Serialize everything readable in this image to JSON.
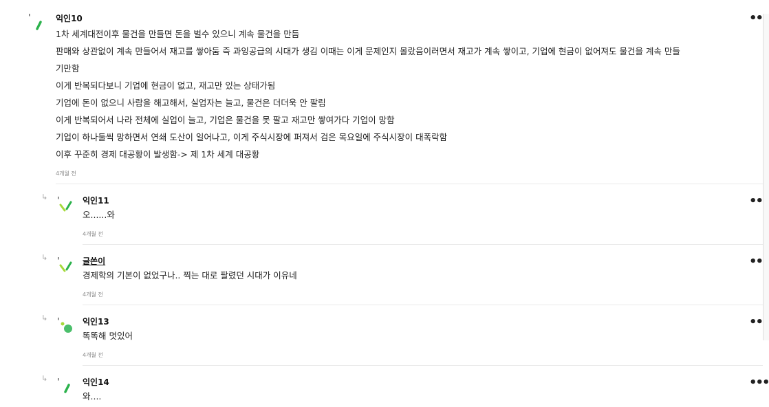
{
  "comments": [
    {
      "author": "익인10",
      "lines": [
        "1차 세계대전이후 물건을 만들면 돈을 벌수 있으니 계속 물건을 만듬",
        "판매와 상관없이 계속 만들어서 재고를 쌓아둠 즉 과잉공급의 시대가 생김 이때는 이게 문제인지 몰랐음이러면서 재고가 계속 쌓이고, 기업에 현금이 없어져도 물건을 계속 만들",
        "기만함",
        "이게 반복되다보니 기업에 현금이 없고, 재고만 있는 상태가됨",
        "기업에 돈이 없으니 사람을 해고해서, 실업자는 늘고, 물건은 더더욱 안 팔림",
        "이게 반복되어서 나라 전체에 실업이 늘고, 기업은 물건을 못 팔고 재고만 쌓여가다 기업이 망함",
        "기업이 하나둘씩 망하면서 연쇄 도산이 일어나고, 이게 주식시장에 퍼져서 검은 목요일에 주식시장이 대폭락함",
        "이후 꾸준히 경제 대공황이 발생함-> 제 1차 세계 대공황"
      ],
      "time": "4개월 전"
    },
    {
      "author": "익인11",
      "lines": [
        "오......와"
      ],
      "time": "4개월 전"
    },
    {
      "author": "글쓴이",
      "lines": [
        "경제학의 기본이 없었구나.. 찍는 대로 팔렸던 시대가 이유네"
      ],
      "time": "4개월 전"
    },
    {
      "author": "익인13",
      "lines": [
        "똑똑해 멋있어"
      ],
      "time": "4개월 전"
    },
    {
      "author": "익인14",
      "lines": [
        "와...."
      ],
      "time": ""
    }
  ],
  "icons": {
    "more": "more-options-icon",
    "reply": "reply-arrow-icon",
    "avatar": "avatar-icon"
  },
  "colors": {
    "avatar_green": "#2bb24c",
    "avatar_lime": "#a6d93b",
    "avatar_dot_green": "#4bbf6b"
  },
  "more_label": "•••",
  "reply_symbol": "↳"
}
